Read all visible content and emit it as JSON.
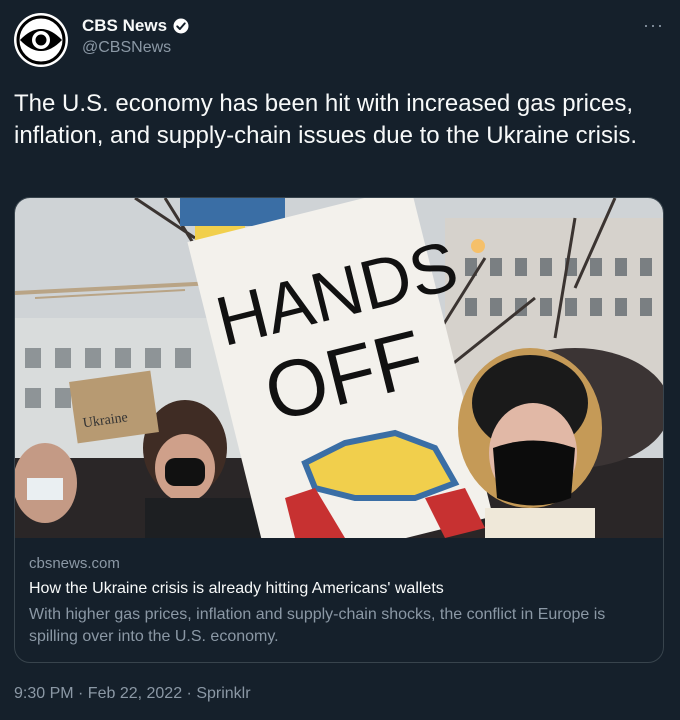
{
  "tweet": {
    "display_name": "CBS News",
    "handle": "@CBSNews",
    "more_label": "···",
    "text": "The U.S. economy has been hit with increased gas prices, inflation, and supply-chain issues due to the Ukraine crisis.",
    "timestamp": "9:30 PM · Feb 22, 2022 · Sprinklr"
  },
  "card": {
    "domain": "cbsnews.com",
    "title": "How the Ukraine crisis is already hitting Americans' wallets",
    "description": "With higher gas prices, inflation and supply-chain shocks, the conflict in Europe is spilling over into the U.S. economy.",
    "image": {
      "sign_line1": "HANDS",
      "sign_line2": "OFF",
      "small_sign": "Ukraine"
    }
  },
  "icons": {
    "avatar": "cbs-eye-logo-icon",
    "verified": "verified-badge-icon",
    "more": "more-options-icon"
  },
  "colors": {
    "background": "#15202b",
    "text": "#f7f9f9",
    "secondary": "#8b98a5",
    "border": "#38444d",
    "verified": "#ffffff"
  }
}
